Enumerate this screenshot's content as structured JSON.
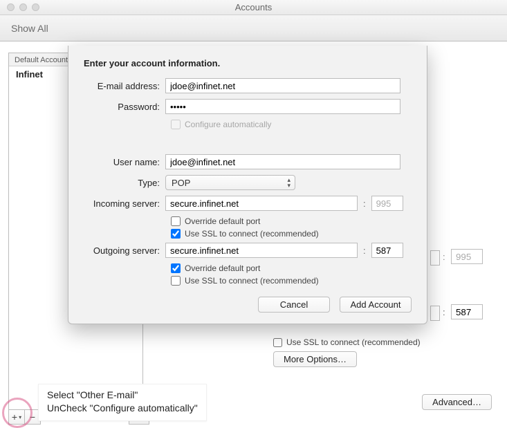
{
  "window": {
    "title": "Accounts",
    "showall": "Show All"
  },
  "sidebar": {
    "heading": "Default Account",
    "item0": "Infinet"
  },
  "toolbar_buttons": {
    "plus": "+",
    "minus": "−",
    "gear": "✻⌄"
  },
  "hint": {
    "line1": "Select \"Other E-mail\"",
    "line2": "UnCheck \"Configure automatically\""
  },
  "advanced": "Advanced…",
  "bg": {
    "port1": "995",
    "port2": "587",
    "ssl_label": "Use SSL to connect (recommended)",
    "more": "More Options…"
  },
  "sheet": {
    "title": "Enter your account information.",
    "email_label": "E-mail address:",
    "email": "jdoe@infinet.net",
    "pass_label": "Password:",
    "pass": "•••••",
    "configure_auto": "Configure automatically",
    "user_label": "User name:",
    "user": "jdoe@infinet.net",
    "type_label": "Type:",
    "type_value": "POP",
    "in_label": "Incoming server:",
    "in_server": "secure.infinet.net",
    "in_port": "995",
    "override": "Override default port",
    "ssl": "Use SSL to connect (recommended)",
    "out_label": "Outgoing server:",
    "out_server": "secure.infinet.net",
    "out_port": "587",
    "cancel": "Cancel",
    "add": "Add Account"
  }
}
